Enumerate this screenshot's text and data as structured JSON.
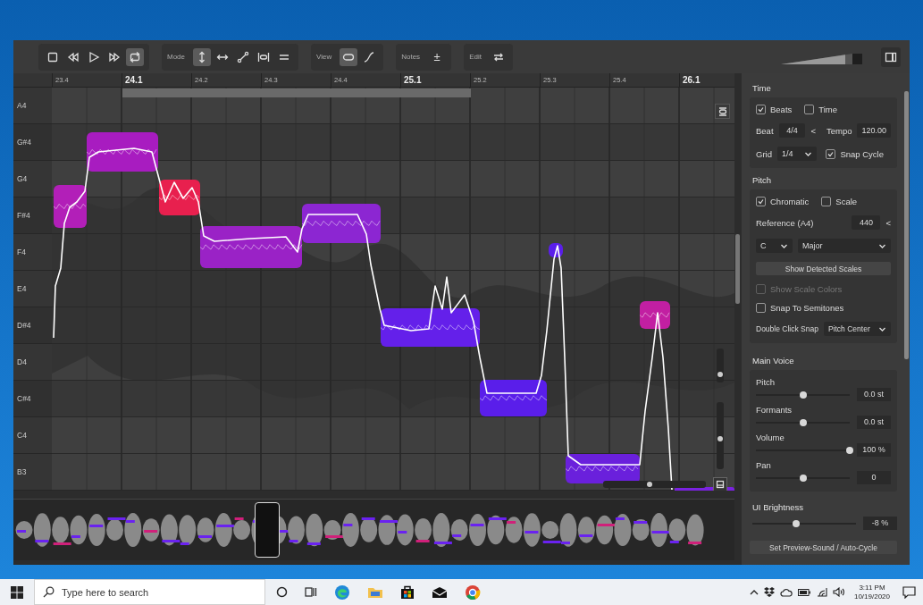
{
  "toolbar": {
    "transport": [
      {
        "selected": false
      },
      {
        "selected": false
      },
      {
        "selected": false
      },
      {
        "selected": false
      },
      {
        "selected": true
      }
    ],
    "mode": {
      "label": "Mode",
      "tools": [
        {
          "selected": true
        },
        {
          "selected": false
        },
        {
          "selected": false
        },
        {
          "selected": false
        },
        {
          "selected": false
        }
      ]
    },
    "view": {
      "label": "View",
      "tools": [
        {
          "selected": true
        },
        {
          "selected": false
        }
      ]
    },
    "notes": {
      "label": "Notes",
      "button": "±"
    },
    "edit": {
      "label": "Edit"
    },
    "output_volume": {
      "level": 0.9
    }
  },
  "ruler": [
    {
      "label": "23.4",
      "kind": "beat"
    },
    {
      "label": "24.1",
      "kind": "bar"
    },
    {
      "label": "24.2",
      "kind": "beat"
    },
    {
      "label": "24.3",
      "kind": "beat"
    },
    {
      "label": "24.4",
      "kind": "beat"
    },
    {
      "label": "25.1",
      "kind": "bar"
    },
    {
      "label": "25.2",
      "kind": "beat"
    },
    {
      "label": "25.3",
      "kind": "beat"
    },
    {
      "label": "25.4",
      "kind": "beat"
    },
    {
      "label": "26.1",
      "kind": "bar"
    }
  ],
  "keys": [
    {
      "label": "A4",
      "kind": "white"
    },
    {
      "label": "G#4",
      "kind": "black"
    },
    {
      "label": "G4",
      "kind": "white"
    },
    {
      "label": "F#4",
      "kind": "black"
    },
    {
      "label": "F4",
      "kind": "white"
    },
    {
      "label": "E4",
      "kind": "white"
    },
    {
      "label": "D#4",
      "kind": "black"
    },
    {
      "label": "D4",
      "kind": "white"
    },
    {
      "label": "C#4",
      "kind": "black"
    },
    {
      "label": "C4",
      "kind": "white"
    },
    {
      "label": "B3",
      "kind": "white"
    }
  ],
  "editor_controls": {
    "vertical_sliders": [
      {
        "level": 0.15
      },
      {
        "level": 0.42
      }
    ],
    "horizontal_slider": {
      "level": 0.43
    }
  },
  "panel": {
    "time": {
      "title": "Time",
      "options": [
        {
          "label": "Beats",
          "checked": true
        },
        {
          "label": "Time",
          "checked": false
        }
      ],
      "beat": {
        "label": "Beat",
        "value": "4/4",
        "stepper": "<"
      },
      "tempo": {
        "label": "Tempo",
        "value": "120.00"
      },
      "grid": {
        "label": "Grid",
        "value": "1/4"
      },
      "snap_cycle": {
        "label": "Snap Cycle",
        "checked": true
      }
    },
    "pitch": {
      "title": "Pitch",
      "options": [
        {
          "label": "Chromatic",
          "checked": true
        },
        {
          "label": "Scale",
          "checked": false
        }
      ],
      "reference": {
        "label": "Reference (A4)",
        "value": "440",
        "stepper": "<"
      },
      "key": "C",
      "scale": "Major",
      "detect_button": "Show Detected Scales",
      "toggles": [
        {
          "label": "Show Scale Colors",
          "checked": false,
          "disabled": true
        },
        {
          "label": "Snap To Semitones",
          "checked": false,
          "disabled": false
        }
      ],
      "double_click_snap": {
        "label": "Double Click Snap",
        "value": "Pitch Center"
      }
    },
    "main_voice": {
      "title": "Main Voice",
      "sliders": [
        {
          "label": "Pitch",
          "level": 0.5,
          "value": "0.0 st"
        },
        {
          "label": "Formants",
          "level": 0.5,
          "value": "0.0 st"
        },
        {
          "label": "Volume",
          "level": 1.0,
          "value": "100 %"
        },
        {
          "label": "Pan",
          "level": 0.5,
          "value": "0"
        }
      ]
    },
    "brightness": {
      "title": "UI Brightness",
      "level": 0.42,
      "value": "-8 %"
    },
    "preview_button": "Set Preview-Sound / Auto-Cycle"
  },
  "taskbar": {
    "search": {
      "placeholder": "Type here to search"
    },
    "time": "3:11 PM",
    "date": "10/19/2020"
  }
}
